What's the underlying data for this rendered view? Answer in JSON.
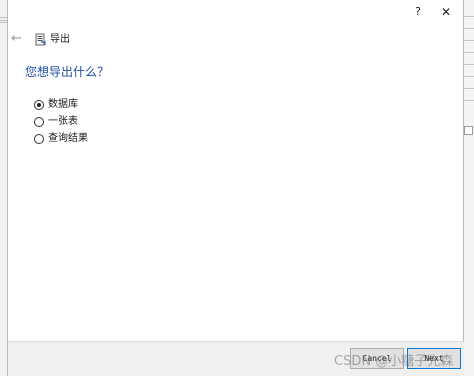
{
  "dialog": {
    "help_label": "?",
    "close_label": "✕",
    "back_icon": "←",
    "header_title": "导出",
    "question": "您想导出什么？",
    "options": [
      {
        "label": "数据库",
        "checked": true
      },
      {
        "label": "一张表",
        "checked": false
      },
      {
        "label": "查询结果",
        "checked": false
      }
    ]
  },
  "footer": {
    "cancel_label": "Cancel",
    "next_label": "Next"
  },
  "watermark": "CSDN @小糖子先森",
  "colors": {
    "question": "#1f4ea3",
    "next_border": "#0078d7"
  }
}
